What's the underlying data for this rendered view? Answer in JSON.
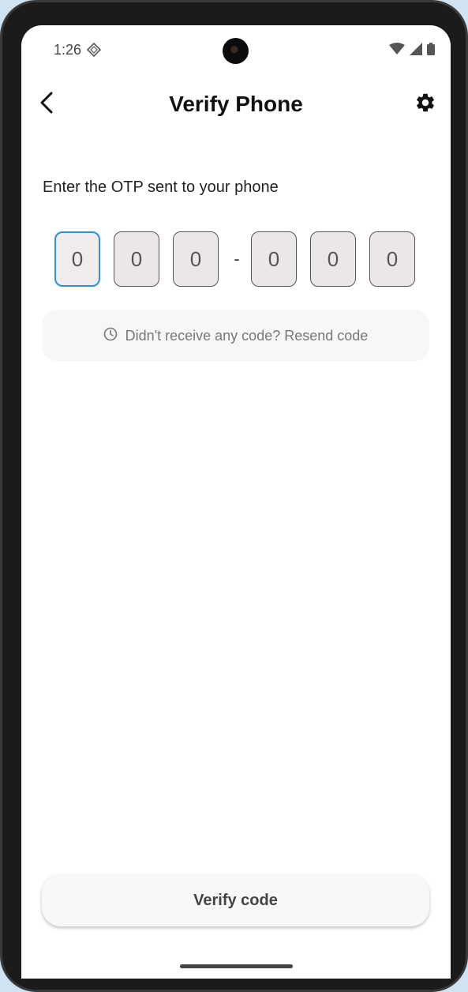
{
  "status": {
    "time": "1:26"
  },
  "appbar": {
    "title": "Verify Phone",
    "back_icon": "chevron-left-icon",
    "settings_icon": "gear-icon"
  },
  "prompt": "Enter the OTP sent to your phone",
  "otp": {
    "digits": [
      "0",
      "0",
      "0",
      "0",
      "0",
      "0"
    ],
    "separator": "-",
    "active_color": "#2f8ee8"
  },
  "resend": {
    "icon": "clock-icon",
    "label": "Didn't receive any code? Resend code"
  },
  "verify": {
    "label": "Verify code"
  }
}
